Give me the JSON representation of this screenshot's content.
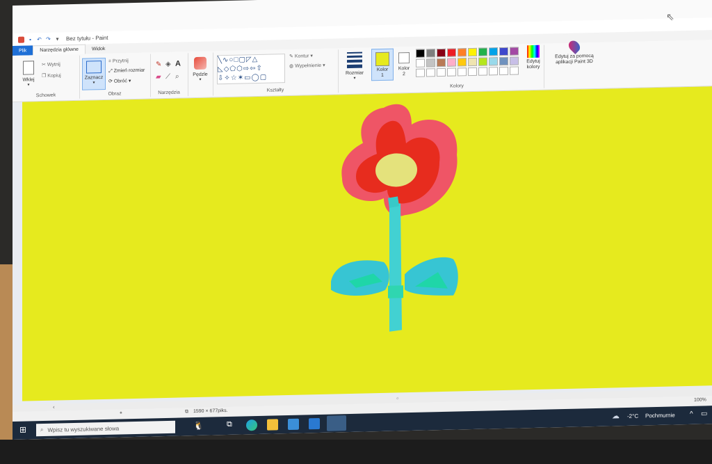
{
  "window": {
    "title": "Bez tytułu - Paint"
  },
  "tabs": [
    "Plik",
    "Narzędzia główne",
    "Widok"
  ],
  "ribbon": {
    "clipboard": {
      "paste": "Wklej",
      "cut": "Wytnij",
      "copy": "Kopiuj",
      "group": "Schowek"
    },
    "image": {
      "select": "Zaznacz",
      "crop": "Przytnij",
      "resize": "Zmień rozmiar",
      "rotate": "Obróć",
      "group": "Obraz"
    },
    "tools": {
      "text_glyph": "A",
      "group": "Narzędzia"
    },
    "brushes": {
      "label": "Pędzle"
    },
    "shapes": {
      "outline": "Kontur",
      "fill": "Wypełnienie",
      "group": "Kształty"
    },
    "size": {
      "label": "Rozmiar"
    },
    "colors": {
      "color1": "Kolor 1",
      "color2": "Kolor 2",
      "edit": "Edytuj kolory",
      "group": "Kolory",
      "color1_value": "#e6ea1e",
      "color2_value": "#ffffff",
      "palette_row1": [
        "#000000",
        "#7f7f7f",
        "#880015",
        "#ed1c24",
        "#ff7f27",
        "#fff200",
        "#22b14c",
        "#00a2e8",
        "#3f48cc",
        "#a349a4"
      ],
      "palette_row2": [
        "#ffffff",
        "#c3c3c3",
        "#b97a57",
        "#ffaec9",
        "#ffc90e",
        "#efe4b0",
        "#b5e61d",
        "#99d9ea",
        "#7092be",
        "#c8bfe7"
      ]
    },
    "paint3d": {
      "label": "Edytuj za pomocą aplikacji Paint 3D"
    }
  },
  "canvas": {
    "background": "#e6ea1e"
  },
  "status": {
    "size": "1590 × 677piks.",
    "zoom": "100%"
  },
  "taskbar": {
    "search_placeholder": "Wpisz tu wyszukiwane słowa",
    "temperature": "-2°C",
    "weather": "Pochmurnie"
  }
}
